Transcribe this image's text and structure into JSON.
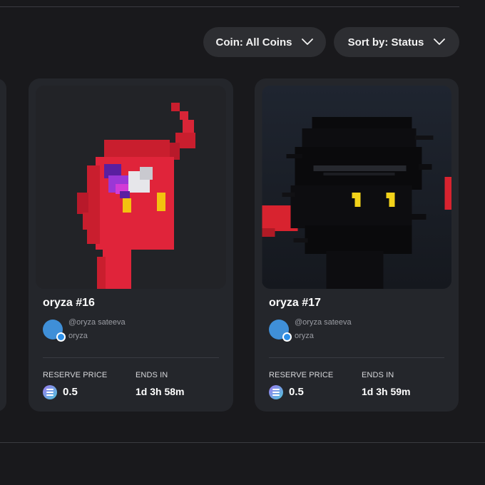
{
  "filters": {
    "coin_label": "Coin: All Coins",
    "sort_label": "Sort by: Status"
  },
  "cards": [
    {
      "name": "oryza #16",
      "handle": "@oryza sateeva",
      "creator": "oryza",
      "reserve_label": "RESERVE PRICE",
      "reserve_value": "0.5",
      "ends_label": "ENDS IN",
      "ends_value": "1d 3h 58m",
      "art": "red pixel devil with horn"
    },
    {
      "name": "oryza #17",
      "handle": "@oryza sateeva",
      "creator": "oryza",
      "reserve_label": "RESERVE PRICE",
      "reserve_value": "0.5",
      "ends_label": "ENDS IN",
      "ends_value": "1d 3h 59m",
      "art": "black glitched pixel ninja"
    }
  ],
  "colors": {
    "background": "#19191c",
    "card": "#24262b",
    "button": "#2d2e32",
    "coin_gradient_start": "#9d7bf0",
    "coin_gradient_end": "#4fc3d9",
    "avatar": "#3f8fd8"
  },
  "icons": [
    "chevron-down-icon",
    "solana-coin-icon",
    "verified-badge-icon"
  ]
}
